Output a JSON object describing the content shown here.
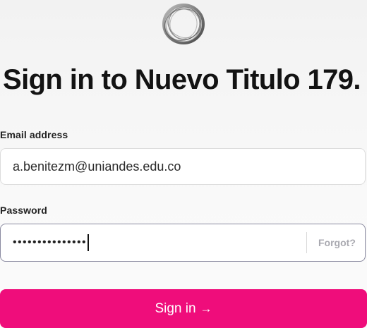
{
  "brand": {
    "logo_icon": "ring-logo-icon"
  },
  "header": {
    "title": "Sign in to Nuevo Titulo 179."
  },
  "form": {
    "email": {
      "label": "Email address",
      "value": "a.benitezm@uniandes.edu.co"
    },
    "password": {
      "label": "Password",
      "masked_value": "•••••••••••••••",
      "forgot_label": "Forgot?"
    },
    "submit": {
      "label": "Sign in",
      "arrow": "→"
    }
  },
  "colors": {
    "primary": "#ef0d7b",
    "title": "#131313",
    "muted": "#a9a9b0"
  }
}
